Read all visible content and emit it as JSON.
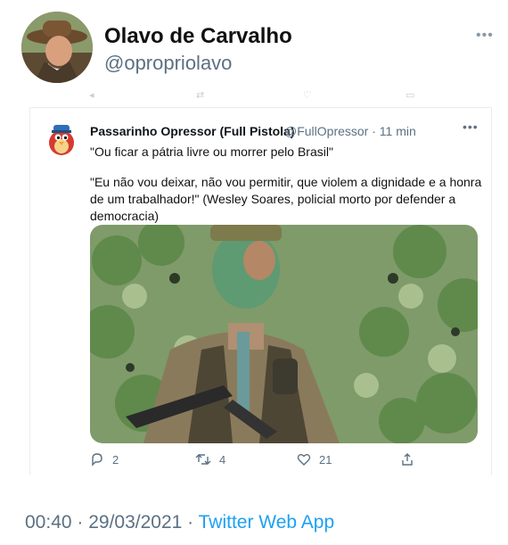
{
  "tweet": {
    "author_name": "Olavo de Carvalho",
    "author_handle": "@opropriolavo",
    "timestamp": "00:40 · 29/03/2021 · ",
    "source": "Twitter Web App"
  },
  "quoted": {
    "name": "Passarinho Opressor (Full Pistola)",
    "handle_time": "@FullOpressor · 11 min",
    "line1": "\"Ou ficar a pátria livre ou morrer pelo Brasil\"",
    "body": "\"Eu não vou deixar, não vou permitir, que violem a dignidade e a honra de um trabalhador!\" (Wesley Soares, policial morto por defender a democracia)",
    "actions": {
      "replies": "2",
      "retweets": "4",
      "likes": "21"
    }
  },
  "colors": {
    "accent": "#1da1f2",
    "secondary_text": "#5b7083",
    "border": "#e6ecf0"
  },
  "icons": [
    "more-icon",
    "reply-icon",
    "retweet-icon",
    "like-icon",
    "share-icon"
  ]
}
